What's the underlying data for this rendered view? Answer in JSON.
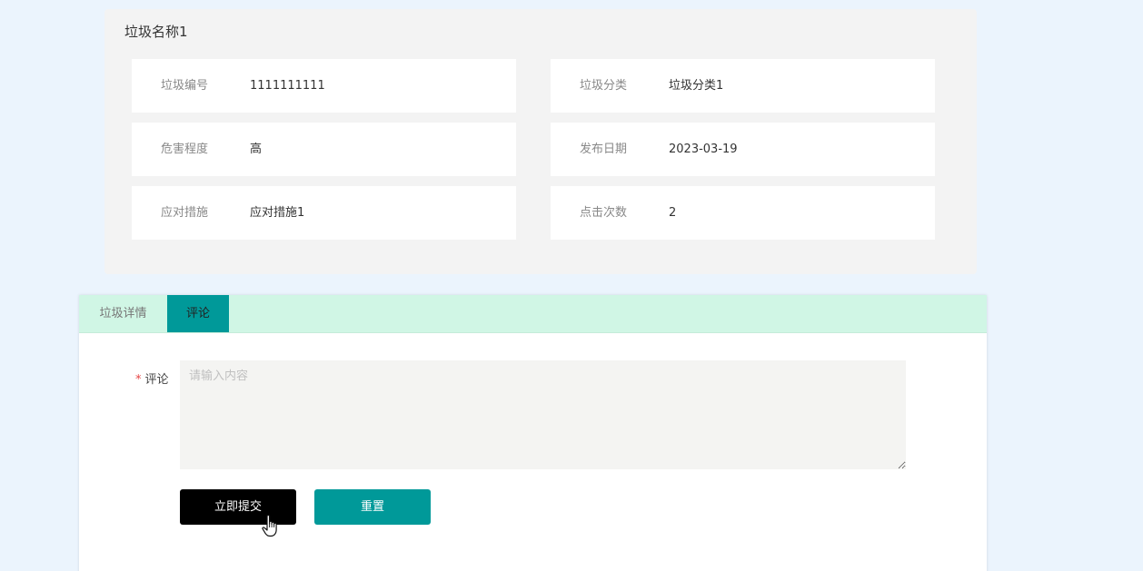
{
  "detail": {
    "title": "垃圾名称1",
    "fields": [
      {
        "label": "垃圾编号",
        "value": "1111111111"
      },
      {
        "label": "垃圾分类",
        "value": "垃圾分类1"
      },
      {
        "label": "危害程度",
        "value": "高"
      },
      {
        "label": "发布日期",
        "value": "2023-03-19"
      },
      {
        "label": "应对措施",
        "value": "应对措施1"
      },
      {
        "label": "点击次数",
        "value": "2"
      }
    ]
  },
  "tabs": [
    {
      "label": "垃圾详情",
      "active": false
    },
    {
      "label": "评论",
      "active": true
    }
  ],
  "comment_form": {
    "required_mark": "*",
    "label": "评论",
    "placeholder": "请输入内容",
    "value": "",
    "submit_label": "立即提交",
    "reset_label": "重置"
  },
  "colors": {
    "accent": "#009999",
    "tab_bar": "#d0f6e5",
    "submit_button": "#000000",
    "required": "#e64545"
  },
  "icons": {
    "cursor": "hand-pointer-icon"
  }
}
